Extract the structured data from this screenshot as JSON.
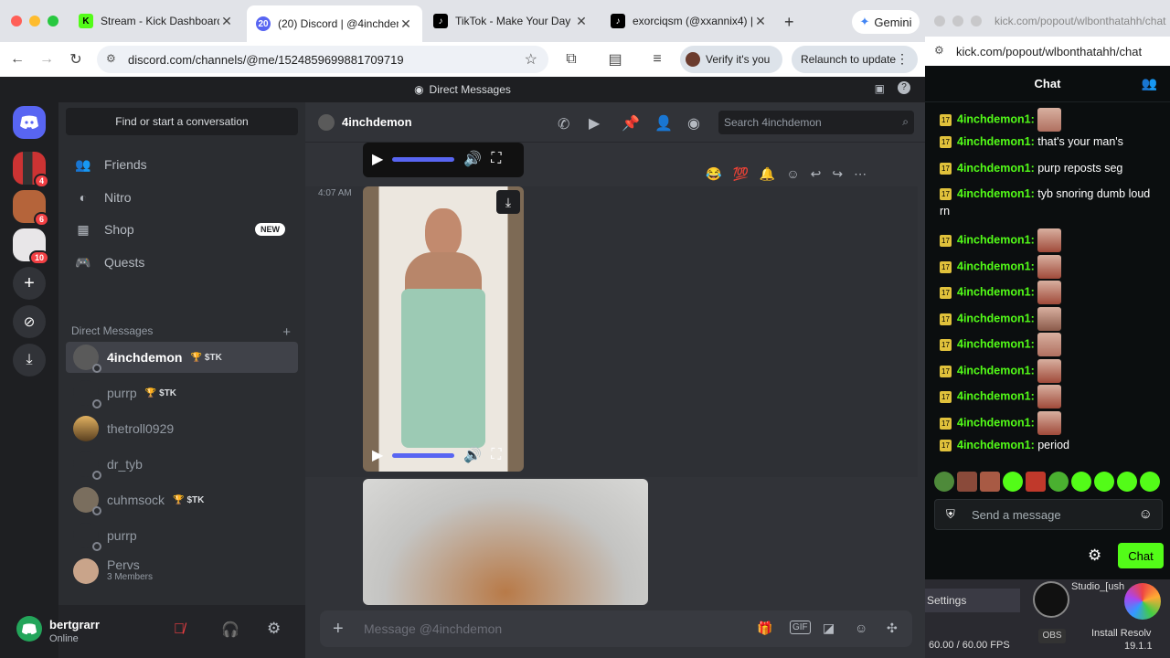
{
  "browser": {
    "tabs": [
      {
        "title": "Stream - Kick Dashboard",
        "color": "#53fc18",
        "icon": "kick-icon"
      },
      {
        "title": "(20) Discord | @4inchdem",
        "color": "#5865f2",
        "icon": "discord-icon"
      },
      {
        "title": "TikTok - Make Your Day",
        "color": "#000000",
        "icon": "tiktok-icon"
      },
      {
        "title": "exorciqsm (@xxannix4) | T",
        "color": "#000000",
        "icon": "tiktok-icon"
      }
    ],
    "gemini_label": "Gemini",
    "url": "discord.com/channels/@me/1524859699881709719",
    "verify_label": "Verify it's you",
    "relaunch_label": "Relaunch to update"
  },
  "discord": {
    "title": "Direct Messages",
    "guild_badges": [
      "4",
      "6",
      "10"
    ],
    "find_conversation": "Find or start a conversation",
    "nav": [
      {
        "label": "Friends",
        "icon": "friends-icon"
      },
      {
        "label": "Nitro",
        "icon": "nitro-icon"
      },
      {
        "label": "Shop",
        "icon": "shop-icon",
        "badge": "NEW"
      },
      {
        "label": "Quests",
        "icon": "quests-icon"
      }
    ],
    "dm_header": "Direct Messages",
    "dms": [
      {
        "name": "4inchdemon",
        "tag": "$TK",
        "selected": true,
        "color": "#5a5a5a"
      },
      {
        "name": "purrp",
        "tag": "$TK",
        "color": "#2b2d31"
      },
      {
        "name": "thetroll0929",
        "color": "#a87a3a"
      },
      {
        "name": "dr_tyb",
        "color": "#2b2d31"
      },
      {
        "name": "cuhmsock",
        "tag": "$TK",
        "color": "#7a6e5e"
      },
      {
        "name": "purrp",
        "color": "#2b2d31"
      },
      {
        "name": "Pervs",
        "sub": "3 Members",
        "color": "#c9a48a"
      }
    ],
    "user": {
      "name": "bertgrarr",
      "status": "Online"
    },
    "channel_name": "4inchdemon",
    "search_placeholder": "Search 4inchdemon",
    "timestamp": "4:07 AM",
    "message_placeholder": "Message @4inchdemon"
  },
  "kick": {
    "url": "kick.com/popout/wlbonthatahh/chat",
    "chat_title": "Chat",
    "messages": [
      {
        "user": "4inchdemon1:",
        "text": "",
        "emote": true
      },
      {
        "user": "4inchdemon1:",
        "text": "that's your man's"
      },
      {
        "user": "4inchdemon1:",
        "text": "purp reposts seg"
      },
      {
        "user": "4inchdemon1:",
        "text": "tyb snoring dumb loud rn"
      },
      {
        "user": "4inchdemon1:",
        "text": "",
        "emote": true
      },
      {
        "user": "4inchdemon1:",
        "text": "",
        "emote": true
      },
      {
        "user": "4inchdemon1:",
        "text": "",
        "emote": true
      },
      {
        "user": "4inchdemon1:",
        "text": "",
        "emote": true
      },
      {
        "user": "4inchdemon1:",
        "text": "",
        "emote": true
      },
      {
        "user": "4inchdemon1:",
        "text": "",
        "emote": true
      },
      {
        "user": "4inchdemon1:",
        "text": "",
        "emote": true
      },
      {
        "user": "4inchdemon1:",
        "text": "",
        "emote": true
      },
      {
        "user": "4inchdemon1:",
        "text": "period"
      }
    ],
    "badge_text": "17",
    "input_placeholder": "Send a message",
    "chat_button": "Chat"
  },
  "obs": {
    "settings_label": "Settings",
    "obs_label": "OBS",
    "fps": "60.00 / 60.00 FPS",
    "studio_label": "Studio_[ush",
    "install_label": "Install Resolv",
    "version": "19.1.1"
  },
  "colors": {
    "discord_blurple": "#5865f2",
    "kick_green": "#53fc18"
  }
}
